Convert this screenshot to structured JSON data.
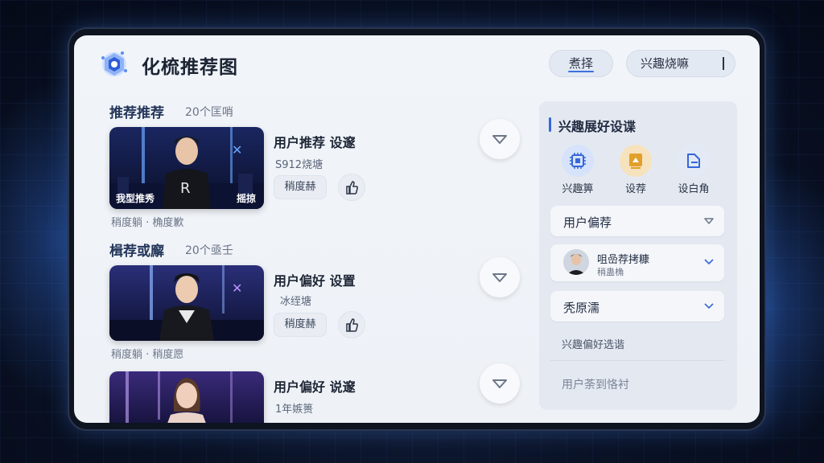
{
  "header": {
    "title": "化梳推荐图",
    "select_label": "煮择",
    "interest_label": "兴趣烧嘛"
  },
  "sections": [
    {
      "title": "推荐推荐",
      "count": "20个匡哨"
    },
    {
      "title": "楫荐或廨",
      "count": "20个亟壬"
    }
  ],
  "items": [
    {
      "title": "用户推荐 设邃",
      "subtitle": "S912烧塘",
      "tag": "稍度赫",
      "meta": "稍度躺 · 桷度歉",
      "thumb_left": "我型推秀",
      "thumb_right": "摇掠"
    },
    {
      "title": "用户偏好 设置",
      "subtitle": "冰绖塘",
      "tag": "稍度赫",
      "meta": "稍度躺 · 稍度愿"
    },
    {
      "title": "用户偏好 说邃",
      "subtitle": "1年嫉篑"
    }
  ],
  "panel": {
    "title": "兴趣展好设谍",
    "icons": [
      {
        "label": "兴趣箅",
        "icon": "chip-icon",
        "color": "#3566d8"
      },
      {
        "label": "设荐",
        "icon": "device-icon",
        "color": "#e0a02a"
      },
      {
        "label": "设白角",
        "icon": "edit-icon",
        "color": "#3566d8"
      }
    ],
    "pref_label": "用户偏荐",
    "user_name": "咀嵒荐拷糠",
    "user_sub": "稍蛊桷",
    "system_label": "秃原濡",
    "text1": "兴趣偏好选谐",
    "text2": "用户荼到恪衬"
  },
  "colors": {
    "accent": "#3566d8",
    "bg": "#0a1226"
  }
}
